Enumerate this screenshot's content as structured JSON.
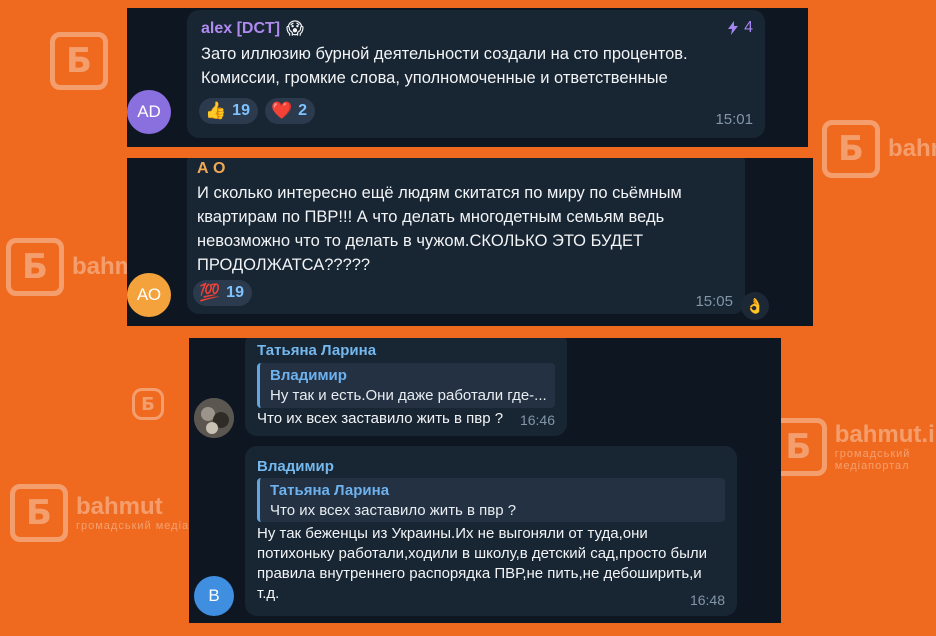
{
  "watermark": {
    "logo_letter": "Б",
    "site": "bahmut.in.ua",
    "site_short": "bahmut",
    "subtitle": "громадський медіапортал"
  },
  "messages": [
    {
      "sender": "alex [DCT]",
      "sender_emoji": "😱",
      "boost": "4",
      "boost_icon": "lightning-icon",
      "text": "Зато иллюзию бурной деятельности создали на сто процентов.\nКомиссии, громкие слова, уполномоченные и ответственные",
      "avatar_initials": "AD",
      "avatar_color": "#8a6fdf",
      "reactions": [
        {
          "emoji": "👍",
          "count": "19"
        },
        {
          "emoji": "❤️",
          "count": "2"
        }
      ],
      "time": "15:01"
    },
    {
      "sender": "А О",
      "text": "И сколько интересно ещё людям скитатся по миру по сьёмным\nквартирам по ПВР!!! А что делать многодетным семьям ведь\nневозможно что то делать в чужом.СКОЛЬКО ЭТО БУДЕТ\nПРОДОЛЖАТСА?????",
      "avatar_initials": "АО",
      "avatar_color": "#f3a23c",
      "reactions": [
        {
          "emoji": "💯",
          "count": "19"
        }
      ],
      "side_reaction": "👌",
      "time": "15:05"
    },
    {
      "sender": "Татьяна Ларина",
      "reply_name": "Владимир",
      "reply_text": "Ну так и есть.Они даже работали где-...",
      "text": "Что их всех заставило жить в пвр ?",
      "time": "16:46"
    },
    {
      "sender": "Владимир",
      "reply_name": "Татьяна Ларина",
      "reply_text": "Что их всех заставило жить в пвр ?",
      "text": "Ну так беженцы из Украины.Их не выгоняли от туда,они\nпотихоньку работали,ходили в школу,в детский сад,просто были\nправила внутреннего распорядка ПВР,не пить,не дебоширить,и\nт.д.",
      "avatar_initials": "В",
      "avatar_color": "#3f8ee0",
      "time": "16:48"
    }
  ]
}
